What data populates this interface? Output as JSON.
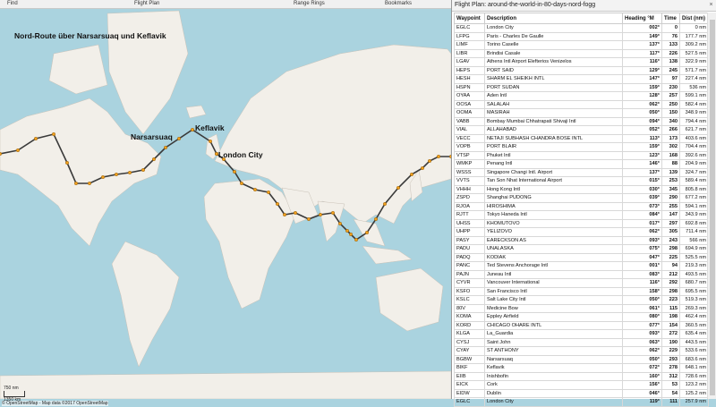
{
  "toolbar": {
    "find": "Find",
    "flight_plan": "Flight Plan",
    "range_rings": "Range Rings",
    "bookmarks": "Bookmarks"
  },
  "map": {
    "title": "Nord-Route über Narsarsuaq und Keflavik",
    "labels": {
      "narsarsuaq": "Narsarsuaq",
      "keflavik": "Keflavik",
      "london": "London City"
    },
    "scale_top": "750 nm",
    "scale_bottom": "1350 km",
    "attribution": "© OpenStreetMap - Map data ©2017 OpenStreetMap",
    "colors": {
      "water": "#aad3df",
      "land": "#f2efe9",
      "route": "#3a3a3a",
      "waypoint": "#f0a020"
    }
  },
  "panel": {
    "title": "Flight Plan: around-the-world-in-80-days-nord-fogg",
    "close_icon": "×",
    "columns": [
      "Waypoint",
      "Description",
      "Heading °M",
      "Time",
      "Dist (nm)"
    ],
    "rows": [
      [
        "EGLC",
        "London City",
        "002°",
        "0",
        "0 nm"
      ],
      [
        "LFPG",
        "Paris - Charles De Gaulle",
        "149°",
        "76",
        "177.7 nm"
      ],
      [
        "LIMF",
        "Torino Caselle",
        "137°",
        "133",
        "309.2 nm"
      ],
      [
        "LIBR",
        "Brindisi Casale",
        "117°",
        "226",
        "527.5 nm"
      ],
      [
        "LGAV",
        "Athens Intl Airport Elefterios Venizelos",
        "116°",
        "138",
        "322.9 nm"
      ],
      [
        "HEPS",
        "PORT SAID",
        "129°",
        "245",
        "571.7 nm"
      ],
      [
        "HESH",
        "SHARM EL SHEIKH INTL",
        "147°",
        "97",
        "227.4 nm"
      ],
      [
        "HSPN",
        "PORT SUDAN",
        "159°",
        "230",
        "536 nm"
      ],
      [
        "OYAA",
        "Aden Intl",
        "128°",
        "257",
        "599.1 nm"
      ],
      [
        "OOSA",
        "SALALAH",
        "062°",
        "250",
        "582.4 nm"
      ],
      [
        "OOMA",
        "MASIRAH",
        "050°",
        "150",
        "348.9 nm"
      ],
      [
        "VABB",
        "Bombay Mumbai Chhatrapati Shivaji Intl",
        "094°",
        "340",
        "794.4 nm"
      ],
      [
        "VIAL",
        "ALLAHABAD",
        "052°",
        "266",
        "621.7 nm"
      ],
      [
        "VECC",
        "NETAJI SUBHASH CHANDRA BOSE INTL",
        "113°",
        "173",
        "403.6 nm"
      ],
      [
        "VOPB",
        "PORT BLAIR",
        "159°",
        "302",
        "704.4 nm"
      ],
      [
        "VTSP",
        "Phuket Intl",
        "123°",
        "168",
        "392.6 nm"
      ],
      [
        "WMKP",
        "Penang Intl",
        "146°",
        "88",
        "204.9 nm"
      ],
      [
        "WSSS",
        "Singapore Changi Intl. Airport",
        "137°",
        "139",
        "324.7 nm"
      ],
      [
        "VVTS",
        "Tan Son Nhat International Airport",
        "015°",
        "253",
        "589.4 nm"
      ],
      [
        "VHHH",
        "Hong Kong Intl",
        "030°",
        "345",
        "805.8 nm"
      ],
      [
        "ZSPD",
        "Shanghai PUDONG",
        "039°",
        "290",
        "677.2 nm"
      ],
      [
        "RJOA",
        "HIROSHIMA",
        "073°",
        "255",
        "594.1 nm"
      ],
      [
        "RJTT",
        "Tokyo Haneda Intl",
        "084°",
        "147",
        "343.9 nm"
      ],
      [
        "UHSS",
        "KHOMUTOVO",
        "017°",
        "297",
        "692.8 nm"
      ],
      [
        "UHPP",
        "YELIZOVO",
        "062°",
        "305",
        "711.4 nm"
      ],
      [
        "PASY",
        "EARECKSON AS",
        "093°",
        "243",
        "566 nm"
      ],
      [
        "PADU",
        "UNALASKA",
        "075°",
        "298",
        "694.9 nm"
      ],
      [
        "PADQ",
        "KODIAK",
        "047°",
        "225",
        "525.5 nm"
      ],
      [
        "PANC",
        "Ted Stevens Anchorage Intl",
        "001°",
        "94",
        "219.3 nm"
      ],
      [
        "PAJN",
        "Juneau Intl",
        "083°",
        "212",
        "493.5 nm"
      ],
      [
        "CYVR",
        "Vancouver International",
        "116°",
        "292",
        "680.7 nm"
      ],
      [
        "KSFO",
        "San Francisco Intl",
        "158°",
        "298",
        "695.5 nm"
      ],
      [
        "KSLC",
        "Salt Lake City Intl",
        "050°",
        "223",
        "519.3 nm"
      ],
      [
        "80V",
        "Medicine Bow",
        "061°",
        "115",
        "269.3 nm"
      ],
      [
        "KOMA",
        "Eppley Airfield",
        "080°",
        "198",
        "462.4 nm"
      ],
      [
        "KORD",
        "CHICAGO OHARE INTL",
        "077°",
        "154",
        "360.5 nm"
      ],
      [
        "KLGA",
        "La_Guardia",
        "093°",
        "272",
        "635.4 nm"
      ],
      [
        "CYSJ",
        "Saint John",
        "063°",
        "190",
        "443.5 nm"
      ],
      [
        "CYAY",
        "ST ANTHONY",
        "062°",
        "229",
        "533.6 nm"
      ],
      [
        "BGBW",
        "Narsarsuaq",
        "050°",
        "293",
        "683.6 nm"
      ],
      [
        "BIKF",
        "Keflavik",
        "072°",
        "278",
        "648.1 nm"
      ],
      [
        "EIIB",
        "Inishbofin",
        "160°",
        "312",
        "728.6 nm"
      ],
      [
        "EICK",
        "Cork",
        "156°",
        "53",
        "123.2 nm"
      ],
      [
        "EIDW",
        "Dublin",
        "046°",
        "54",
        "125.2 nm"
      ],
      [
        "EGLC",
        "London City",
        "119°",
        "111",
        "257.9 nm"
      ]
    ]
  }
}
